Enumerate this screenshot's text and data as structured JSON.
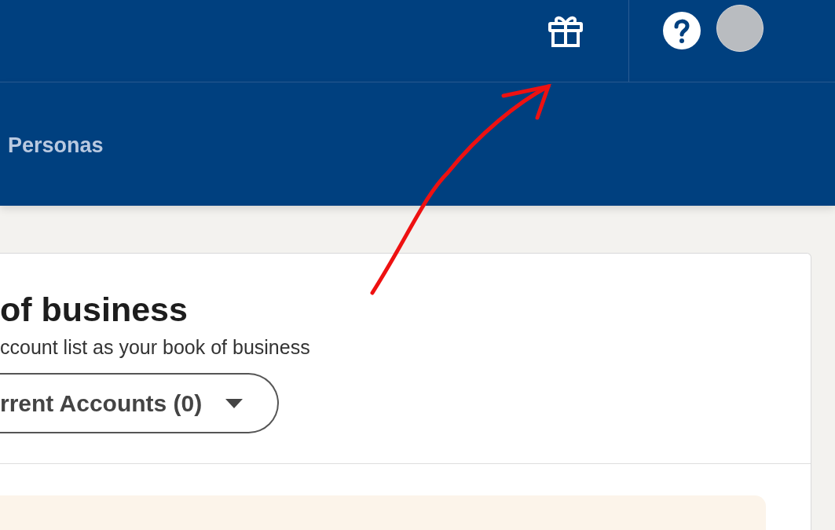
{
  "nav": {
    "items": [
      {
        "label": "Personas",
        "selected": false
      }
    ]
  },
  "card": {
    "title": "of business",
    "subtitle": "ccount list as your book of business",
    "dropdown": {
      "value": "rrent Accounts (0)"
    }
  }
}
